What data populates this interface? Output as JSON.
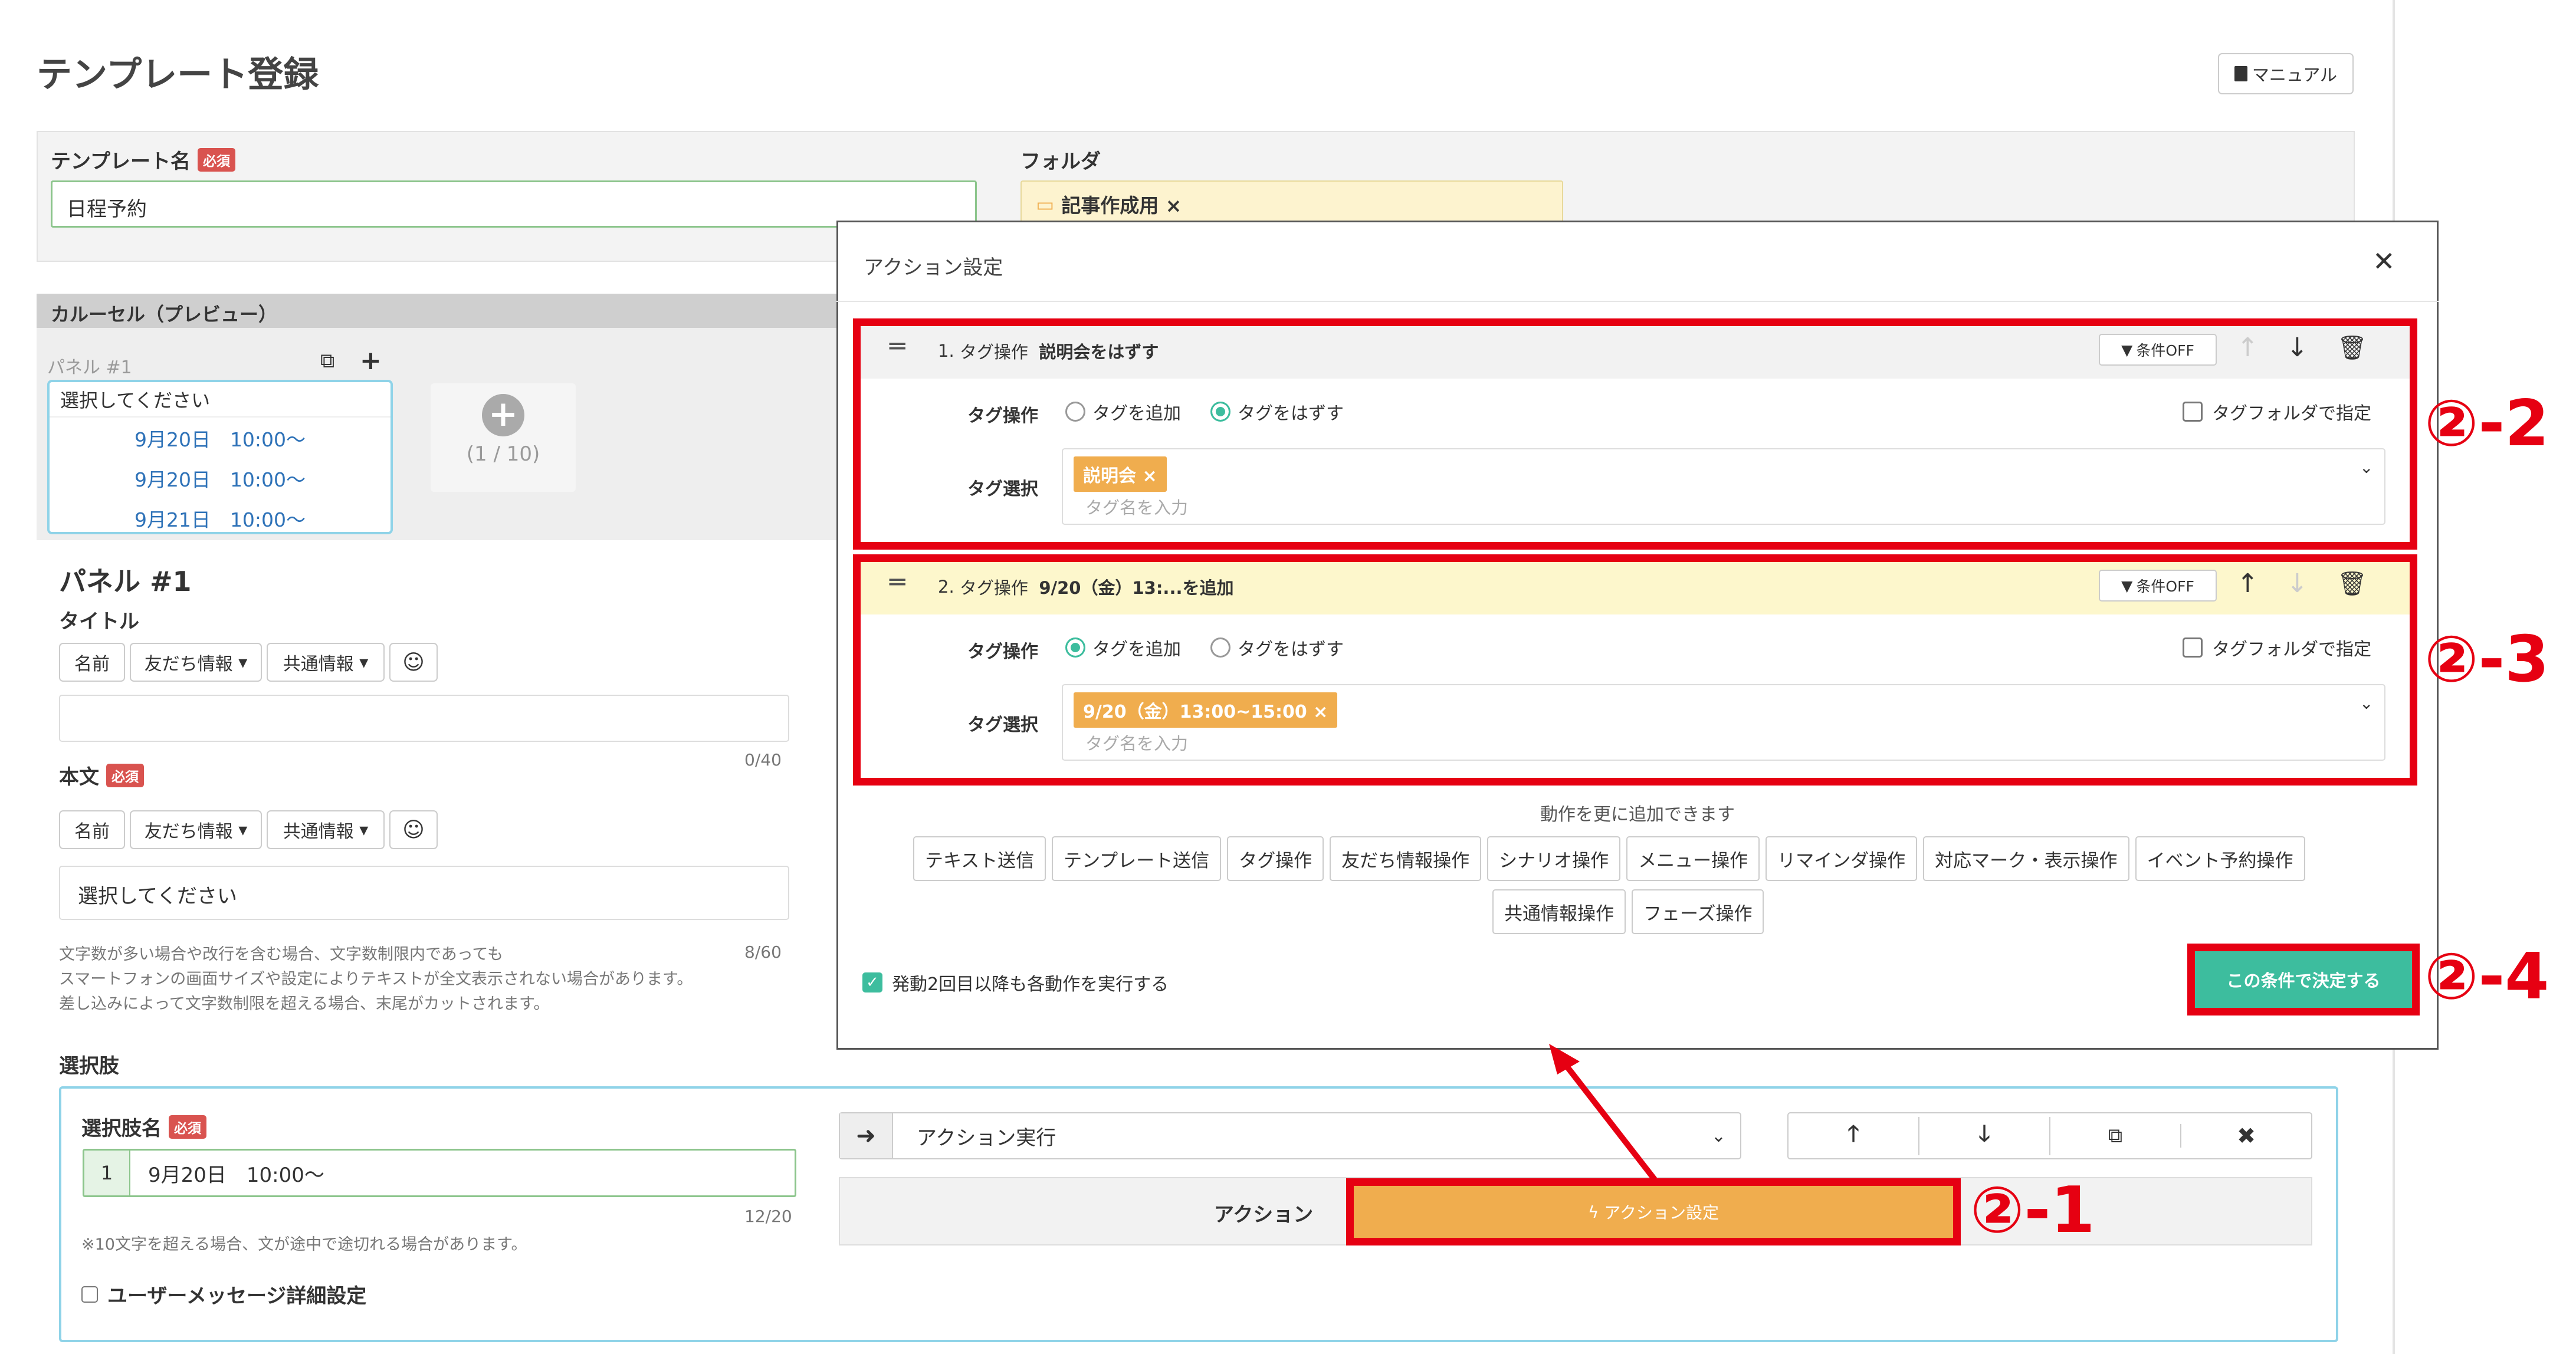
{
  "page": {
    "title": "テンプレート登録",
    "manual_label": "マニュアル"
  },
  "form": {
    "template_name_label": "テンプレート名",
    "required": "必須",
    "template_name_value": "日程予約",
    "folder_label": "フォルダ",
    "folder_value": "記事作成用 ×"
  },
  "carousel": {
    "header": "カルーセル（プレビュー）",
    "panel_tag": "パネル #1",
    "preview_title": "選択してください",
    "preview_items": [
      "9月20日　10:00〜",
      "9月20日　10:00〜",
      "9月21日　10:00〜"
    ],
    "counter": "(1 / 10)"
  },
  "panel": {
    "heading": "パネル #1",
    "title_label": "タイトル",
    "title_count": "0/40",
    "body_label": "本文",
    "body_value": "選択してください",
    "body_count": "8/60",
    "notes": [
      "文字数が多い場合や改行を含む場合、文字数制限内であっても",
      "スマートフォンの画面サイズや設定によりテキストが全文表示されない場合があります。",
      "差し込みによって文字数制限を超える場合、末尾がカットされます。"
    ],
    "insert_buttons": [
      "名前",
      "友だち情報",
      "共通情報"
    ]
  },
  "choices": {
    "label": "選択肢",
    "name_label": "選択肢名",
    "index": "1",
    "value": "9月20日　10:00〜",
    "count": "12/20",
    "note": "※10文字を超える場合、文が途中で途切れる場合があります。",
    "user_msg_label": "ユーザーメッセージ詳細設定",
    "action_type": "アクション実行",
    "action_label": "アクション",
    "action_button": "アクション設定"
  },
  "modal": {
    "title": "アクション設定",
    "cond_off": "条件OFF",
    "op_label": "タグ操作",
    "add_label": "タグを追加",
    "remove_label": "タグをはずす",
    "folder_spec": "タグフォルダで指定",
    "select_label": "タグ選択",
    "placeholder": "タグ名を入力",
    "actions": [
      {
        "num": "1.",
        "kind": "タグ操作",
        "summary": "説明会をはずす",
        "tag": "説明会 ×",
        "mode": "remove"
      },
      {
        "num": "2.",
        "kind": "タグ操作",
        "summary": "9/20（金）13:...を追加",
        "tag": "9/20（金）13:00~15:00 ×",
        "mode": "add"
      }
    ],
    "more_text": "動作を更に追加できます",
    "add_buttons_row1": [
      "テキスト送信",
      "テンプレート送信",
      "タグ操作",
      "友だち情報操作",
      "シナリオ操作",
      "メニュー操作",
      "リマインダ操作",
      "対応マーク・表示操作",
      "イベント予約操作"
    ],
    "add_buttons_row2": [
      "共通情報操作",
      "フェーズ操作"
    ],
    "repeat_label": "発動2回目以降も各動作を実行する",
    "confirm": "この条件で決定する"
  },
  "annotations": {
    "a1": "②-1",
    "a2": "②-2",
    "a3": "②-3",
    "a4": "②-4"
  },
  "colors": {
    "accent": "#3dbd9e",
    "required": "#d9534f",
    "tag": "#f0ad4e",
    "highlight": "#e60012",
    "action_button": "#f0ad4e"
  }
}
